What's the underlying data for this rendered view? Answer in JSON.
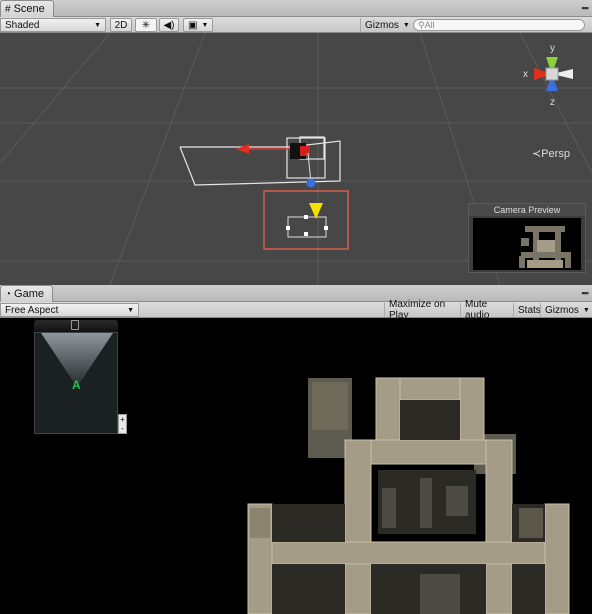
{
  "scene": {
    "tab_label": "Scene",
    "tab_icon": "grid-icon",
    "shading_mode": "Shaded",
    "btn_2d": "2D",
    "gizmos_label": "Gizmos",
    "search_placeholder": "All",
    "persp_label": "Persp",
    "axis_x": "x",
    "axis_y": "y",
    "axis_z": "z",
    "camera_preview_title": "Camera Preview"
  },
  "game": {
    "tab_label": "Game",
    "tab_icon": "pacman-icon",
    "aspect": "Free Aspect",
    "maximize_on_play": "Maximize on Play",
    "mute_audio": "Mute audio",
    "stats": "Stats",
    "gizmos_label": "Gizmos",
    "player_marker": "A",
    "zoom_plus": "+",
    "zoom_minus": "-"
  },
  "colors": {
    "axis_x": "#e2301c",
    "axis_y": "#8bd23a",
    "axis_z": "#3a6fdc",
    "selection": "#e06050",
    "cone": "#f5e000",
    "player": "#19c84a"
  }
}
